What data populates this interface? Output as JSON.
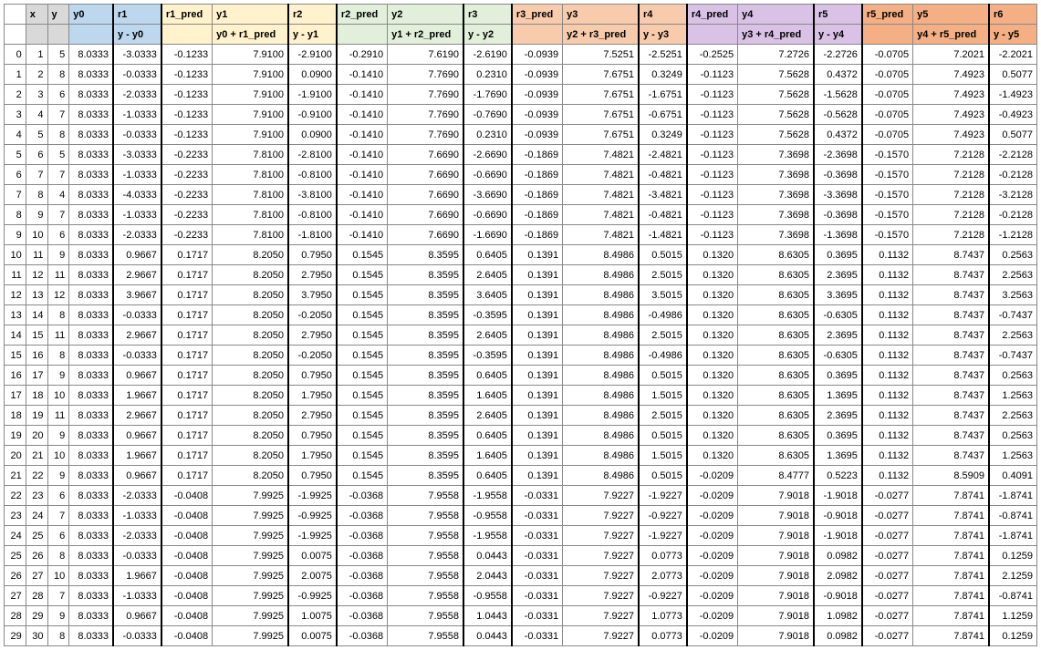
{
  "columns": [
    {
      "key": "idx",
      "label": "",
      "class": "idx",
      "sub": ""
    },
    {
      "key": "x",
      "label": "x",
      "class": "x",
      "sub": ""
    },
    {
      "key": "y",
      "label": "y",
      "class": "y",
      "sub": ""
    },
    {
      "key": "y0",
      "label": "y0",
      "class": "y0",
      "sub": ""
    },
    {
      "key": "r1",
      "label": "r1",
      "class": "r1",
      "sub": "y - y0",
      "bl": true
    },
    {
      "key": "r1_pred",
      "label": "r1_pred",
      "class": "r1_pred",
      "sub": "",
      "bl": true
    },
    {
      "key": "y1",
      "label": "y1",
      "class": "y1",
      "sub": "y0 + r1_pred"
    },
    {
      "key": "r2",
      "label": "r2",
      "class": "r2",
      "sub": "y - y1",
      "bl": true
    },
    {
      "key": "r2_pred",
      "label": "r2_pred",
      "class": "r2_pred",
      "sub": "",
      "bl": true
    },
    {
      "key": "y2",
      "label": "y2",
      "class": "y2",
      "sub": "y1 + r2_pred"
    },
    {
      "key": "r3",
      "label": "r3",
      "class": "r3",
      "sub": "y - y2",
      "bl": true
    },
    {
      "key": "r3_pred",
      "label": "r3_pred",
      "class": "r3_pred",
      "sub": "",
      "bl": true
    },
    {
      "key": "y3",
      "label": "y3",
      "class": "y3",
      "sub": "y2 + r3_pred"
    },
    {
      "key": "r4",
      "label": "r4",
      "class": "r4",
      "sub": "y - y3",
      "bl": true
    },
    {
      "key": "r4_pred",
      "label": "r4_pred",
      "class": "r4_pred",
      "sub": "",
      "bl": true
    },
    {
      "key": "y4",
      "label": "y4",
      "class": "y4",
      "sub": "y3 + r4_pred"
    },
    {
      "key": "r5",
      "label": "r5",
      "class": "r5",
      "sub": "y - y4",
      "bl": true
    },
    {
      "key": "r5_pred",
      "label": "r5_pred",
      "class": "r5_pred",
      "sub": "",
      "bl": true
    },
    {
      "key": "y5",
      "label": "y5",
      "class": "y5",
      "sub": "y4 + r5_pred"
    },
    {
      "key": "r6",
      "label": "r6",
      "class": "r6",
      "sub": "y - y5",
      "bl": true
    }
  ],
  "rows": [
    {
      "idx": 0,
      "x": 1,
      "y": 5,
      "y0": "8.0333",
      "r1": "-3.0333",
      "r1_pred": "-0.1233",
      "y1": "7.9100",
      "r2": "-2.9100",
      "r2_pred": "-0.2910",
      "y2": "7.6190",
      "r3": "-2.6190",
      "r3_pred": "-0.0939",
      "y3": "7.5251",
      "r4": "-2.5251",
      "r4_pred": "-0.2525",
      "y4": "7.2726",
      "r5": "-2.2726",
      "r5_pred": "-0.0705",
      "y5": "7.2021",
      "r6": "-2.2021"
    },
    {
      "idx": 1,
      "x": 2,
      "y": 8,
      "y0": "8.0333",
      "r1": "-0.0333",
      "r1_pred": "-0.1233",
      "y1": "7.9100",
      "r2": "0.0900",
      "r2_pred": "-0.1410",
      "y2": "7.7690",
      "r3": "0.2310",
      "r3_pred": "-0.0939",
      "y3": "7.6751",
      "r4": "0.3249",
      "r4_pred": "-0.1123",
      "y4": "7.5628",
      "r5": "0.4372",
      "r5_pred": "-0.0705",
      "y5": "7.4923",
      "r6": "0.5077"
    },
    {
      "idx": 2,
      "x": 3,
      "y": 6,
      "y0": "8.0333",
      "r1": "-2.0333",
      "r1_pred": "-0.1233",
      "y1": "7.9100",
      "r2": "-1.9100",
      "r2_pred": "-0.1410",
      "y2": "7.7690",
      "r3": "-1.7690",
      "r3_pred": "-0.0939",
      "y3": "7.6751",
      "r4": "-1.6751",
      "r4_pred": "-0.1123",
      "y4": "7.5628",
      "r5": "-1.5628",
      "r5_pred": "-0.0705",
      "y5": "7.4923",
      "r6": "-1.4923"
    },
    {
      "idx": 3,
      "x": 4,
      "y": 7,
      "y0": "8.0333",
      "r1": "-1.0333",
      "r1_pred": "-0.1233",
      "y1": "7.9100",
      "r2": "-0.9100",
      "r2_pred": "-0.1410",
      "y2": "7.7690",
      "r3": "-0.7690",
      "r3_pred": "-0.0939",
      "y3": "7.6751",
      "r4": "-0.6751",
      "r4_pred": "-0.1123",
      "y4": "7.5628",
      "r5": "-0.5628",
      "r5_pred": "-0.0705",
      "y5": "7.4923",
      "r6": "-0.4923"
    },
    {
      "idx": 4,
      "x": 5,
      "y": 8,
      "y0": "8.0333",
      "r1": "-0.0333",
      "r1_pred": "-0.1233",
      "y1": "7.9100",
      "r2": "0.0900",
      "r2_pred": "-0.1410",
      "y2": "7.7690",
      "r3": "0.2310",
      "r3_pred": "-0.0939",
      "y3": "7.6751",
      "r4": "0.3249",
      "r4_pred": "-0.1123",
      "y4": "7.5628",
      "r5": "0.4372",
      "r5_pred": "-0.0705",
      "y5": "7.4923",
      "r6": "0.5077"
    },
    {
      "idx": 5,
      "x": 6,
      "y": 5,
      "y0": "8.0333",
      "r1": "-3.0333",
      "r1_pred": "-0.2233",
      "y1": "7.8100",
      "r2": "-2.8100",
      "r2_pred": "-0.1410",
      "y2": "7.6690",
      "r3": "-2.6690",
      "r3_pred": "-0.1869",
      "y3": "7.4821",
      "r4": "-2.4821",
      "r4_pred": "-0.1123",
      "y4": "7.3698",
      "r5": "-2.3698",
      "r5_pred": "-0.1570",
      "y5": "7.2128",
      "r6": "-2.2128"
    },
    {
      "idx": 6,
      "x": 7,
      "y": 7,
      "y0": "8.0333",
      "r1": "-1.0333",
      "r1_pred": "-0.2233",
      "y1": "7.8100",
      "r2": "-0.8100",
      "r2_pred": "-0.1410",
      "y2": "7.6690",
      "r3": "-0.6690",
      "r3_pred": "-0.1869",
      "y3": "7.4821",
      "r4": "-0.4821",
      "r4_pred": "-0.1123",
      "y4": "7.3698",
      "r5": "-0.3698",
      "r5_pred": "-0.1570",
      "y5": "7.2128",
      "r6": "-0.2128"
    },
    {
      "idx": 7,
      "x": 8,
      "y": 4,
      "y0": "8.0333",
      "r1": "-4.0333",
      "r1_pred": "-0.2233",
      "y1": "7.8100",
      "r2": "-3.8100",
      "r2_pred": "-0.1410",
      "y2": "7.6690",
      "r3": "-3.6690",
      "r3_pred": "-0.1869",
      "y3": "7.4821",
      "r4": "-3.4821",
      "r4_pred": "-0.1123",
      "y4": "7.3698",
      "r5": "-3.3698",
      "r5_pred": "-0.1570",
      "y5": "7.2128",
      "r6": "-3.2128"
    },
    {
      "idx": 8,
      "x": 9,
      "y": 7,
      "y0": "8.0333",
      "r1": "-1.0333",
      "r1_pred": "-0.2233",
      "y1": "7.8100",
      "r2": "-0.8100",
      "r2_pred": "-0.1410",
      "y2": "7.6690",
      "r3": "-0.6690",
      "r3_pred": "-0.1869",
      "y3": "7.4821",
      "r4": "-0.4821",
      "r4_pred": "-0.1123",
      "y4": "7.3698",
      "r5": "-0.3698",
      "r5_pred": "-0.1570",
      "y5": "7.2128",
      "r6": "-0.2128"
    },
    {
      "idx": 9,
      "x": 10,
      "y": 6,
      "y0": "8.0333",
      "r1": "-2.0333",
      "r1_pred": "-0.2233",
      "y1": "7.8100",
      "r2": "-1.8100",
      "r2_pred": "-0.1410",
      "y2": "7.6690",
      "r3": "-1.6690",
      "r3_pred": "-0.1869",
      "y3": "7.4821",
      "r4": "-1.4821",
      "r4_pred": "-0.1123",
      "y4": "7.3698",
      "r5": "-1.3698",
      "r5_pred": "-0.1570",
      "y5": "7.2128",
      "r6": "-1.2128"
    },
    {
      "idx": 10,
      "x": 11,
      "y": 9,
      "y0": "8.0333",
      "r1": "0.9667",
      "r1_pred": "0.1717",
      "y1": "8.2050",
      "r2": "0.7950",
      "r2_pred": "0.1545",
      "y2": "8.3595",
      "r3": "0.6405",
      "r3_pred": "0.1391",
      "y3": "8.4986",
      "r4": "0.5015",
      "r4_pred": "0.1320",
      "y4": "8.6305",
      "r5": "0.3695",
      "r5_pred": "0.1132",
      "y5": "8.7437",
      "r6": "0.2563"
    },
    {
      "idx": 11,
      "x": 12,
      "y": 11,
      "y0": "8.0333",
      "r1": "2.9667",
      "r1_pred": "0.1717",
      "y1": "8.2050",
      "r2": "2.7950",
      "r2_pred": "0.1545",
      "y2": "8.3595",
      "r3": "2.6405",
      "r3_pred": "0.1391",
      "y3": "8.4986",
      "r4": "2.5015",
      "r4_pred": "0.1320",
      "y4": "8.6305",
      "r5": "2.3695",
      "r5_pred": "0.1132",
      "y5": "8.7437",
      "r6": "2.2563"
    },
    {
      "idx": 12,
      "x": 13,
      "y": 12,
      "y0": "8.0333",
      "r1": "3.9667",
      "r1_pred": "0.1717",
      "y1": "8.2050",
      "r2": "3.7950",
      "r2_pred": "0.1545",
      "y2": "8.3595",
      "r3": "3.6405",
      "r3_pred": "0.1391",
      "y3": "8.4986",
      "r4": "3.5015",
      "r4_pred": "0.1320",
      "y4": "8.6305",
      "r5": "3.3695",
      "r5_pred": "0.1132",
      "y5": "8.7437",
      "r6": "3.2563"
    },
    {
      "idx": 13,
      "x": 14,
      "y": 8,
      "y0": "8.0333",
      "r1": "-0.0333",
      "r1_pred": "0.1717",
      "y1": "8.2050",
      "r2": "-0.2050",
      "r2_pred": "0.1545",
      "y2": "8.3595",
      "r3": "-0.3595",
      "r3_pred": "0.1391",
      "y3": "8.4986",
      "r4": "-0.4986",
      "r4_pred": "0.1320",
      "y4": "8.6305",
      "r5": "-0.6305",
      "r5_pred": "0.1132",
      "y5": "8.7437",
      "r6": "-0.7437"
    },
    {
      "idx": 14,
      "x": 15,
      "y": 11,
      "y0": "8.0333",
      "r1": "2.9667",
      "r1_pred": "0.1717",
      "y1": "8.2050",
      "r2": "2.7950",
      "r2_pred": "0.1545",
      "y2": "8.3595",
      "r3": "2.6405",
      "r3_pred": "0.1391",
      "y3": "8.4986",
      "r4": "2.5015",
      "r4_pred": "0.1320",
      "y4": "8.6305",
      "r5": "2.3695",
      "r5_pred": "0.1132",
      "y5": "8.7437",
      "r6": "2.2563"
    },
    {
      "idx": 15,
      "x": 16,
      "y": 8,
      "y0": "8.0333",
      "r1": "-0.0333",
      "r1_pred": "0.1717",
      "y1": "8.2050",
      "r2": "-0.2050",
      "r2_pred": "0.1545",
      "y2": "8.3595",
      "r3": "-0.3595",
      "r3_pred": "0.1391",
      "y3": "8.4986",
      "r4": "-0.4986",
      "r4_pred": "0.1320",
      "y4": "8.6305",
      "r5": "-0.6305",
      "r5_pred": "0.1132",
      "y5": "8.7437",
      "r6": "-0.7437"
    },
    {
      "idx": 16,
      "x": 17,
      "y": 9,
      "y0": "8.0333",
      "r1": "0.9667",
      "r1_pred": "0.1717",
      "y1": "8.2050",
      "r2": "0.7950",
      "r2_pred": "0.1545",
      "y2": "8.3595",
      "r3": "0.6405",
      "r3_pred": "0.1391",
      "y3": "8.4986",
      "r4": "0.5015",
      "r4_pred": "0.1320",
      "y4": "8.6305",
      "r5": "0.3695",
      "r5_pred": "0.1132",
      "y5": "8.7437",
      "r6": "0.2563"
    },
    {
      "idx": 17,
      "x": 18,
      "y": 10,
      "y0": "8.0333",
      "r1": "1.9667",
      "r1_pred": "0.1717",
      "y1": "8.2050",
      "r2": "1.7950",
      "r2_pred": "0.1545",
      "y2": "8.3595",
      "r3": "1.6405",
      "r3_pred": "0.1391",
      "y3": "8.4986",
      "r4": "1.5015",
      "r4_pred": "0.1320",
      "y4": "8.6305",
      "r5": "1.3695",
      "r5_pred": "0.1132",
      "y5": "8.7437",
      "r6": "1.2563"
    },
    {
      "idx": 18,
      "x": 19,
      "y": 11,
      "y0": "8.0333",
      "r1": "2.9667",
      "r1_pred": "0.1717",
      "y1": "8.2050",
      "r2": "2.7950",
      "r2_pred": "0.1545",
      "y2": "8.3595",
      "r3": "2.6405",
      "r3_pred": "0.1391",
      "y3": "8.4986",
      "r4": "2.5015",
      "r4_pred": "0.1320",
      "y4": "8.6305",
      "r5": "2.3695",
      "r5_pred": "0.1132",
      "y5": "8.7437",
      "r6": "2.2563"
    },
    {
      "idx": 19,
      "x": 20,
      "y": 9,
      "y0": "8.0333",
      "r1": "0.9667",
      "r1_pred": "0.1717",
      "y1": "8.2050",
      "r2": "0.7950",
      "r2_pred": "0.1545",
      "y2": "8.3595",
      "r3": "0.6405",
      "r3_pred": "0.1391",
      "y3": "8.4986",
      "r4": "0.5015",
      "r4_pred": "0.1320",
      "y4": "8.6305",
      "r5": "0.3695",
      "r5_pred": "0.1132",
      "y5": "8.7437",
      "r6": "0.2563"
    },
    {
      "idx": 20,
      "x": 21,
      "y": 10,
      "y0": "8.0333",
      "r1": "1.9667",
      "r1_pred": "0.1717",
      "y1": "8.2050",
      "r2": "1.7950",
      "r2_pred": "0.1545",
      "y2": "8.3595",
      "r3": "1.6405",
      "r3_pred": "0.1391",
      "y3": "8.4986",
      "r4": "1.5015",
      "r4_pred": "0.1320",
      "y4": "8.6305",
      "r5": "1.3695",
      "r5_pred": "0.1132",
      "y5": "8.7437",
      "r6": "1.2563"
    },
    {
      "idx": 21,
      "x": 22,
      "y": 9,
      "y0": "8.0333",
      "r1": "0.9667",
      "r1_pred": "0.1717",
      "y1": "8.2050",
      "r2": "0.7950",
      "r2_pred": "0.1545",
      "y2": "8.3595",
      "r3": "0.6405",
      "r3_pred": "0.1391",
      "y3": "8.4986",
      "r4": "0.5015",
      "r4_pred": "-0.0209",
      "y4": "8.4777",
      "r5": "0.5223",
      "r5_pred": "0.1132",
      "y5": "8.5909",
      "r6": "0.4091"
    },
    {
      "idx": 22,
      "x": 23,
      "y": 6,
      "y0": "8.0333",
      "r1": "-2.0333",
      "r1_pred": "-0.0408",
      "y1": "7.9925",
      "r2": "-1.9925",
      "r2_pred": "-0.0368",
      "y2": "7.9558",
      "r3": "-1.9558",
      "r3_pred": "-0.0331",
      "y3": "7.9227",
      "r4": "-1.9227",
      "r4_pred": "-0.0209",
      "y4": "7.9018",
      "r5": "-1.9018",
      "r5_pred": "-0.0277",
      "y5": "7.8741",
      "r6": "-1.8741"
    },
    {
      "idx": 23,
      "x": 24,
      "y": 7,
      "y0": "8.0333",
      "r1": "-1.0333",
      "r1_pred": "-0.0408",
      "y1": "7.9925",
      "r2": "-0.9925",
      "r2_pred": "-0.0368",
      "y2": "7.9558",
      "r3": "-0.9558",
      "r3_pred": "-0.0331",
      "y3": "7.9227",
      "r4": "-0.9227",
      "r4_pred": "-0.0209",
      "y4": "7.9018",
      "r5": "-0.9018",
      "r5_pred": "-0.0277",
      "y5": "7.8741",
      "r6": "-0.8741"
    },
    {
      "idx": 24,
      "x": 25,
      "y": 6,
      "y0": "8.0333",
      "r1": "-2.0333",
      "r1_pred": "-0.0408",
      "y1": "7.9925",
      "r2": "-1.9925",
      "r2_pred": "-0.0368",
      "y2": "7.9558",
      "r3": "-1.9558",
      "r3_pred": "-0.0331",
      "y3": "7.9227",
      "r4": "-1.9227",
      "r4_pred": "-0.0209",
      "y4": "7.9018",
      "r5": "-1.9018",
      "r5_pred": "-0.0277",
      "y5": "7.8741",
      "r6": "-1.8741"
    },
    {
      "idx": 25,
      "x": 26,
      "y": 8,
      "y0": "8.0333",
      "r1": "-0.0333",
      "r1_pred": "-0.0408",
      "y1": "7.9925",
      "r2": "0.0075",
      "r2_pred": "-0.0368",
      "y2": "7.9558",
      "r3": "0.0443",
      "r3_pred": "-0.0331",
      "y3": "7.9227",
      "r4": "0.0773",
      "r4_pred": "-0.0209",
      "y4": "7.9018",
      "r5": "0.0982",
      "r5_pred": "-0.0277",
      "y5": "7.8741",
      "r6": "0.1259"
    },
    {
      "idx": 26,
      "x": 27,
      "y": 10,
      "y0": "8.0333",
      "r1": "1.9667",
      "r1_pred": "-0.0408",
      "y1": "7.9925",
      "r2": "2.0075",
      "r2_pred": "-0.0368",
      "y2": "7.9558",
      "r3": "2.0443",
      "r3_pred": "-0.0331",
      "y3": "7.9227",
      "r4": "2.0773",
      "r4_pred": "-0.0209",
      "y4": "7.9018",
      "r5": "2.0982",
      "r5_pred": "-0.0277",
      "y5": "7.8741",
      "r6": "2.1259"
    },
    {
      "idx": 27,
      "x": 28,
      "y": 7,
      "y0": "8.0333",
      "r1": "-1.0333",
      "r1_pred": "-0.0408",
      "y1": "7.9925",
      "r2": "-0.9925",
      "r2_pred": "-0.0368",
      "y2": "7.9558",
      "r3": "-0.9558",
      "r3_pred": "-0.0331",
      "y3": "7.9227",
      "r4": "-0.9227",
      "r4_pred": "-0.0209",
      "y4": "7.9018",
      "r5": "-0.9018",
      "r5_pred": "-0.0277",
      "y5": "7.8741",
      "r6": "-0.8741"
    },
    {
      "idx": 28,
      "x": 29,
      "y": 9,
      "y0": "8.0333",
      "r1": "0.9667",
      "r1_pred": "-0.0408",
      "y1": "7.9925",
      "r2": "1.0075",
      "r2_pred": "-0.0368",
      "y2": "7.9558",
      "r3": "1.0443",
      "r3_pred": "-0.0331",
      "y3": "7.9227",
      "r4": "1.0773",
      "r4_pred": "-0.0209",
      "y4": "7.9018",
      "r5": "1.0982",
      "r5_pred": "-0.0277",
      "y5": "7.8741",
      "r6": "1.1259"
    },
    {
      "idx": 29,
      "x": 30,
      "y": 8,
      "y0": "8.0333",
      "r1": "-0.0333",
      "r1_pred": "-0.0408",
      "y1": "7.9925",
      "r2": "0.0075",
      "r2_pred": "-0.0368",
      "y2": "7.9558",
      "r3": "0.0443",
      "r3_pred": "-0.0331",
      "y3": "7.9227",
      "r4": "0.0773",
      "r4_pred": "-0.0209",
      "y4": "7.9018",
      "r5": "0.0982",
      "r5_pred": "-0.0277",
      "y5": "7.8741",
      "r6": "0.1259"
    }
  ]
}
